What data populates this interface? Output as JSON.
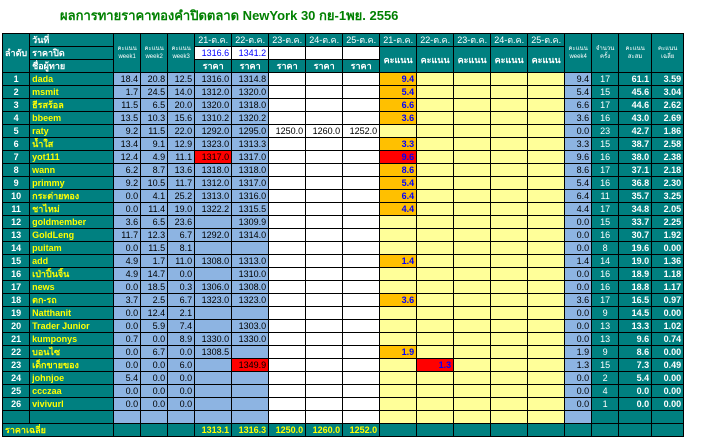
{
  "title": "ผลการทายราคาทองคำปิดตลาด NewYork 30 กย-1พย. 2556",
  "header": {
    "col_rank": "ลำดับ",
    "row_date": "วันที่",
    "row_close": "ราคาปิด",
    "row_name": "ชื่อผู้ทาย",
    "week1": "คะแนน week1",
    "week2": "คะแนน week2",
    "week3": "คะแนน week3",
    "price_dates": [
      "21-ต.ค.",
      "22-ต.ค.",
      "23-ต.ค.",
      "24-ต.ค.",
      "25-ต.ค."
    ],
    "close_prices": [
      "1316.6",
      "1341.2",
      "",
      "",
      ""
    ],
    "price_label": "ราคา",
    "score_dates": [
      "21-ต.ค.",
      "22-ต.ค.",
      "23-ต.ค.",
      "24-ต.ค.",
      "25-ต.ค."
    ],
    "score_label": "คะแนน",
    "week4": "คะแนน week4",
    "count": "จำนวนครั้ง",
    "total": "คะแนน สะสม",
    "avg": "คะแนน เฉลี่ย"
  },
  "rows": [
    {
      "i": "1",
      "n": "dada",
      "w1": "18.4",
      "w2": "20.8",
      "w3": "12.5",
      "p": [
        "1316.0",
        "1314.8",
        "",
        "",
        ""
      ],
      "s": [
        "9.4",
        "",
        "",
        "",
        ""
      ],
      "w4": "9.4",
      "c": "17",
      "t": "61.1",
      "a": "3.59"
    },
    {
      "i": "2",
      "n": "msmit",
      "w1": "1.7",
      "w2": "24.5",
      "w3": "14.0",
      "p": [
        "1312.0",
        "1320.0",
        "",
        "",
        ""
      ],
      "s": [
        "5.4",
        "",
        "",
        "",
        ""
      ],
      "w4": "5.4",
      "c": "15",
      "t": "45.6",
      "a": "3.04"
    },
    {
      "i": "3",
      "n": "ธีรสร้อล",
      "w1": "11.5",
      "w2": "6.5",
      "w3": "20.0",
      "p": [
        "1320.0",
        "1318.0",
        "",
        "",
        ""
      ],
      "s": [
        "6.6",
        "",
        "",
        "",
        ""
      ],
      "w4": "6.6",
      "c": "17",
      "t": "44.6",
      "a": "2.62"
    },
    {
      "i": "4",
      "n": "bbeem",
      "w1": "13.5",
      "w2": "10.3",
      "w3": "15.6",
      "p": [
        "1310.2",
        "1320.2",
        "",
        "",
        ""
      ],
      "s": [
        "3.6",
        "",
        "",
        "",
        ""
      ],
      "w4": "3.6",
      "c": "16",
      "t": "43.0",
      "a": "2.69"
    },
    {
      "i": "5",
      "n": "raty",
      "w1": "9.2",
      "w2": "11.5",
      "w3": "22.0",
      "p": [
        "1292.0",
        "1295.0",
        "1250.0",
        "1260.0",
        "1252.0"
      ],
      "s": [
        "",
        "",
        "",
        "",
        ""
      ],
      "w4": "0.0",
      "c": "23",
      "t": "42.7",
      "a": "1.86"
    },
    {
      "i": "6",
      "n": "น้ำใส",
      "w1": "13.4",
      "w2": "9.1",
      "w3": "12.9",
      "p": [
        "1323.0",
        "1313.3",
        "",
        "",
        ""
      ],
      "s": [
        "3.3",
        "",
        "",
        "",
        ""
      ],
      "w4": "3.3",
      "c": "15",
      "t": "38.7",
      "a": "2.58"
    },
    {
      "i": "7",
      "n": "yot111",
      "w1": "12.4",
      "w2": "4.9",
      "w3": "11.1",
      "p": [
        "1317.0",
        "1317.0",
        "",
        "",
        ""
      ],
      "s": [
        "9.6",
        "",
        "",
        "",
        ""
      ],
      "w4": "9.6",
      "c": "16",
      "t": "38.0",
      "a": "2.38"
    },
    {
      "i": "8",
      "n": "wann",
      "w1": "6.2",
      "w2": "8.7",
      "w3": "13.6",
      "p": [
        "1318.0",
        "1318.0",
        "",
        "",
        ""
      ],
      "s": [
        "8.6",
        "",
        "",
        "",
        ""
      ],
      "w4": "8.6",
      "c": "17",
      "t": "37.1",
      "a": "2.18"
    },
    {
      "i": "9",
      "n": "primmy",
      "w1": "9.2",
      "w2": "10.5",
      "w3": "11.7",
      "p": [
        "1312.0",
        "1317.0",
        "",
        "",
        ""
      ],
      "s": [
        "5.4",
        "",
        "",
        "",
        ""
      ],
      "w4": "5.4",
      "c": "16",
      "t": "36.8",
      "a": "2.30"
    },
    {
      "i": "10",
      "n": "กระต่ายทอง",
      "w1": "0.0",
      "w2": "4.1",
      "w3": "25.2",
      "p": [
        "1313.0",
        "1316.0",
        "",
        "",
        ""
      ],
      "s": [
        "6.4",
        "",
        "",
        "",
        ""
      ],
      "w4": "6.4",
      "c": "11",
      "t": "35.7",
      "a": "3.25"
    },
    {
      "i": "11",
      "n": "ชาไหม่",
      "w1": "0.0",
      "w2": "11.4",
      "w3": "19.0",
      "p": [
        "1322.2",
        "1315.5",
        "",
        "",
        ""
      ],
      "s": [
        "4.4",
        "",
        "",
        "",
        ""
      ],
      "w4": "4.4",
      "c": "17",
      "t": "34.8",
      "a": "2.05"
    },
    {
      "i": "12",
      "n": "goldmember",
      "w1": "3.6",
      "w2": "6.5",
      "w3": "23.6",
      "p": [
        "",
        "1309.9",
        "",
        "",
        ""
      ],
      "s": [
        "",
        "",
        "",
        "",
        ""
      ],
      "w4": "0.0",
      "c": "15",
      "t": "33.7",
      "a": "2.25"
    },
    {
      "i": "13",
      "n": "GoldLeng",
      "w1": "11.7",
      "w2": "12.3",
      "w3": "6.7",
      "p": [
        "1292.0",
        "1314.0",
        "",
        "",
        ""
      ],
      "s": [
        "",
        "",
        "",
        "",
        ""
      ],
      "w4": "0.0",
      "c": "16",
      "t": "30.7",
      "a": "1.92"
    },
    {
      "i": "14",
      "n": "puitam",
      "w1": "0.0",
      "w2": "11.5",
      "w3": "8.1",
      "p": [
        "",
        "",
        "",
        "",
        ""
      ],
      "s": [
        "",
        "",
        "",
        "",
        ""
      ],
      "w4": "0.0",
      "c": "8",
      "t": "19.6",
      "a": "0.00"
    },
    {
      "i": "15",
      "n": "add",
      "w1": "4.9",
      "w2": "1.7",
      "w3": "11.0",
      "p": [
        "1308.0",
        "1313.0",
        "",
        "",
        ""
      ],
      "s": [
        "1.4",
        "",
        "",
        "",
        ""
      ],
      "w4": "1.4",
      "c": "14",
      "t": "19.0",
      "a": "1.36"
    },
    {
      "i": "16",
      "n": "เป่าปิ้นจิ้น",
      "w1": "4.9",
      "w2": "14.7",
      "w3": "0.0",
      "p": [
        "",
        "1310.0",
        "",
        "",
        ""
      ],
      "s": [
        "",
        "",
        "",
        "",
        ""
      ],
      "w4": "0.0",
      "c": "16",
      "t": "18.9",
      "a": "1.18"
    },
    {
      "i": "17",
      "n": "news",
      "w1": "0.0",
      "w2": "18.5",
      "w3": "0.3",
      "p": [
        "1306.0",
        "1308.0",
        "",
        "",
        ""
      ],
      "s": [
        "",
        "",
        "",
        "",
        ""
      ],
      "w4": "0.0",
      "c": "16",
      "t": "18.8",
      "a": "1.17"
    },
    {
      "i": "18",
      "n": "ตก-รถ",
      "w1": "3.7",
      "w2": "2.5",
      "w3": "6.7",
      "p": [
        "1323.0",
        "1323.0",
        "",
        "",
        ""
      ],
      "s": [
        "3.6",
        "",
        "",
        "",
        ""
      ],
      "w4": "3.6",
      "c": "17",
      "t": "16.5",
      "a": "0.97"
    },
    {
      "i": "19",
      "n": "Natthanit",
      "w1": "0.0",
      "w2": "12.4",
      "w3": "2.1",
      "p": [
        "",
        "",
        "",
        "",
        ""
      ],
      "s": [
        "",
        "",
        "",
        "",
        ""
      ],
      "w4": "0.0",
      "c": "9",
      "t": "14.5",
      "a": "0.00"
    },
    {
      "i": "20",
      "n": "Trader Junior",
      "w1": "0.0",
      "w2": "5.9",
      "w3": "7.4",
      "p": [
        "",
        "1303.0",
        "",
        "",
        ""
      ],
      "s": [
        "",
        "",
        "",
        "",
        ""
      ],
      "w4": "0.0",
      "c": "13",
      "t": "13.3",
      "a": "1.02"
    },
    {
      "i": "21",
      "n": "kumponys",
      "w1": "0.7",
      "w2": "0.0",
      "w3": "8.9",
      "p": [
        "1330.0",
        "1330.0",
        "",
        "",
        ""
      ],
      "s": [
        "",
        "",
        "",
        "",
        ""
      ],
      "w4": "0.0",
      "c": "13",
      "t": "9.6",
      "a": "0.74"
    },
    {
      "i": "22",
      "n": "บอนไซ",
      "w1": "0.0",
      "w2": "6.7",
      "w3": "0.0",
      "p": [
        "1308.5",
        "",
        "",
        "",
        ""
      ],
      "s": [
        "1.9",
        "",
        "",
        "",
        ""
      ],
      "w4": "1.9",
      "c": "9",
      "t": "8.6",
      "a": "0.00"
    },
    {
      "i": "23",
      "n": "เด็กขายของ",
      "w1": "0.0",
      "w2": "0.0",
      "w3": "6.0",
      "p": [
        "",
        "1349.9",
        "",
        "",
        ""
      ],
      "s": [
        "",
        "1.3",
        "",
        "",
        ""
      ],
      "w4": "1.3",
      "c": "15",
      "t": "7.3",
      "a": "0.49"
    },
    {
      "i": "24",
      "n": "johnjoe",
      "w1": "5.4",
      "w2": "0.0",
      "w3": "0.0",
      "p": [
        "",
        "",
        "",
        "",
        ""
      ],
      "s": [
        "",
        "",
        "",
        "",
        ""
      ],
      "w4": "0.0",
      "c": "2",
      "t": "5.4",
      "a": "0.00"
    },
    {
      "i": "25",
      "n": "ccczaa",
      "w1": "0.0",
      "w2": "0.0",
      "w3": "0.0",
      "p": [
        "",
        "",
        "",
        "",
        ""
      ],
      "s": [
        "",
        "",
        "",
        "",
        ""
      ],
      "w4": "0.0",
      "c": "4",
      "t": "0.0",
      "a": "0.00"
    },
    {
      "i": "26",
      "n": "vivivurl",
      "w1": "0.0",
      "w2": "0.0",
      "w3": "0.0",
      "p": [
        "",
        "",
        "",
        "",
        ""
      ],
      "s": [
        "",
        "",
        "",
        "",
        ""
      ],
      "w4": "0.0",
      "c": "1",
      "t": "0.0",
      "a": "0.00"
    }
  ],
  "footer": {
    "label": "ราคาเฉลี่ย",
    "prices": [
      "1313.1",
      "1316.3",
      "1250.0",
      "1260.0",
      "1252.0"
    ]
  },
  "colors": {
    "header_teal": "#008080",
    "name_yellow": "#ffff00",
    "price_blue": "#8db4e2",
    "score_yellow": "#ffff99",
    "score_orange": "#ffc000",
    "highlight_red": "#ff0000",
    "title_green": "#008000"
  }
}
